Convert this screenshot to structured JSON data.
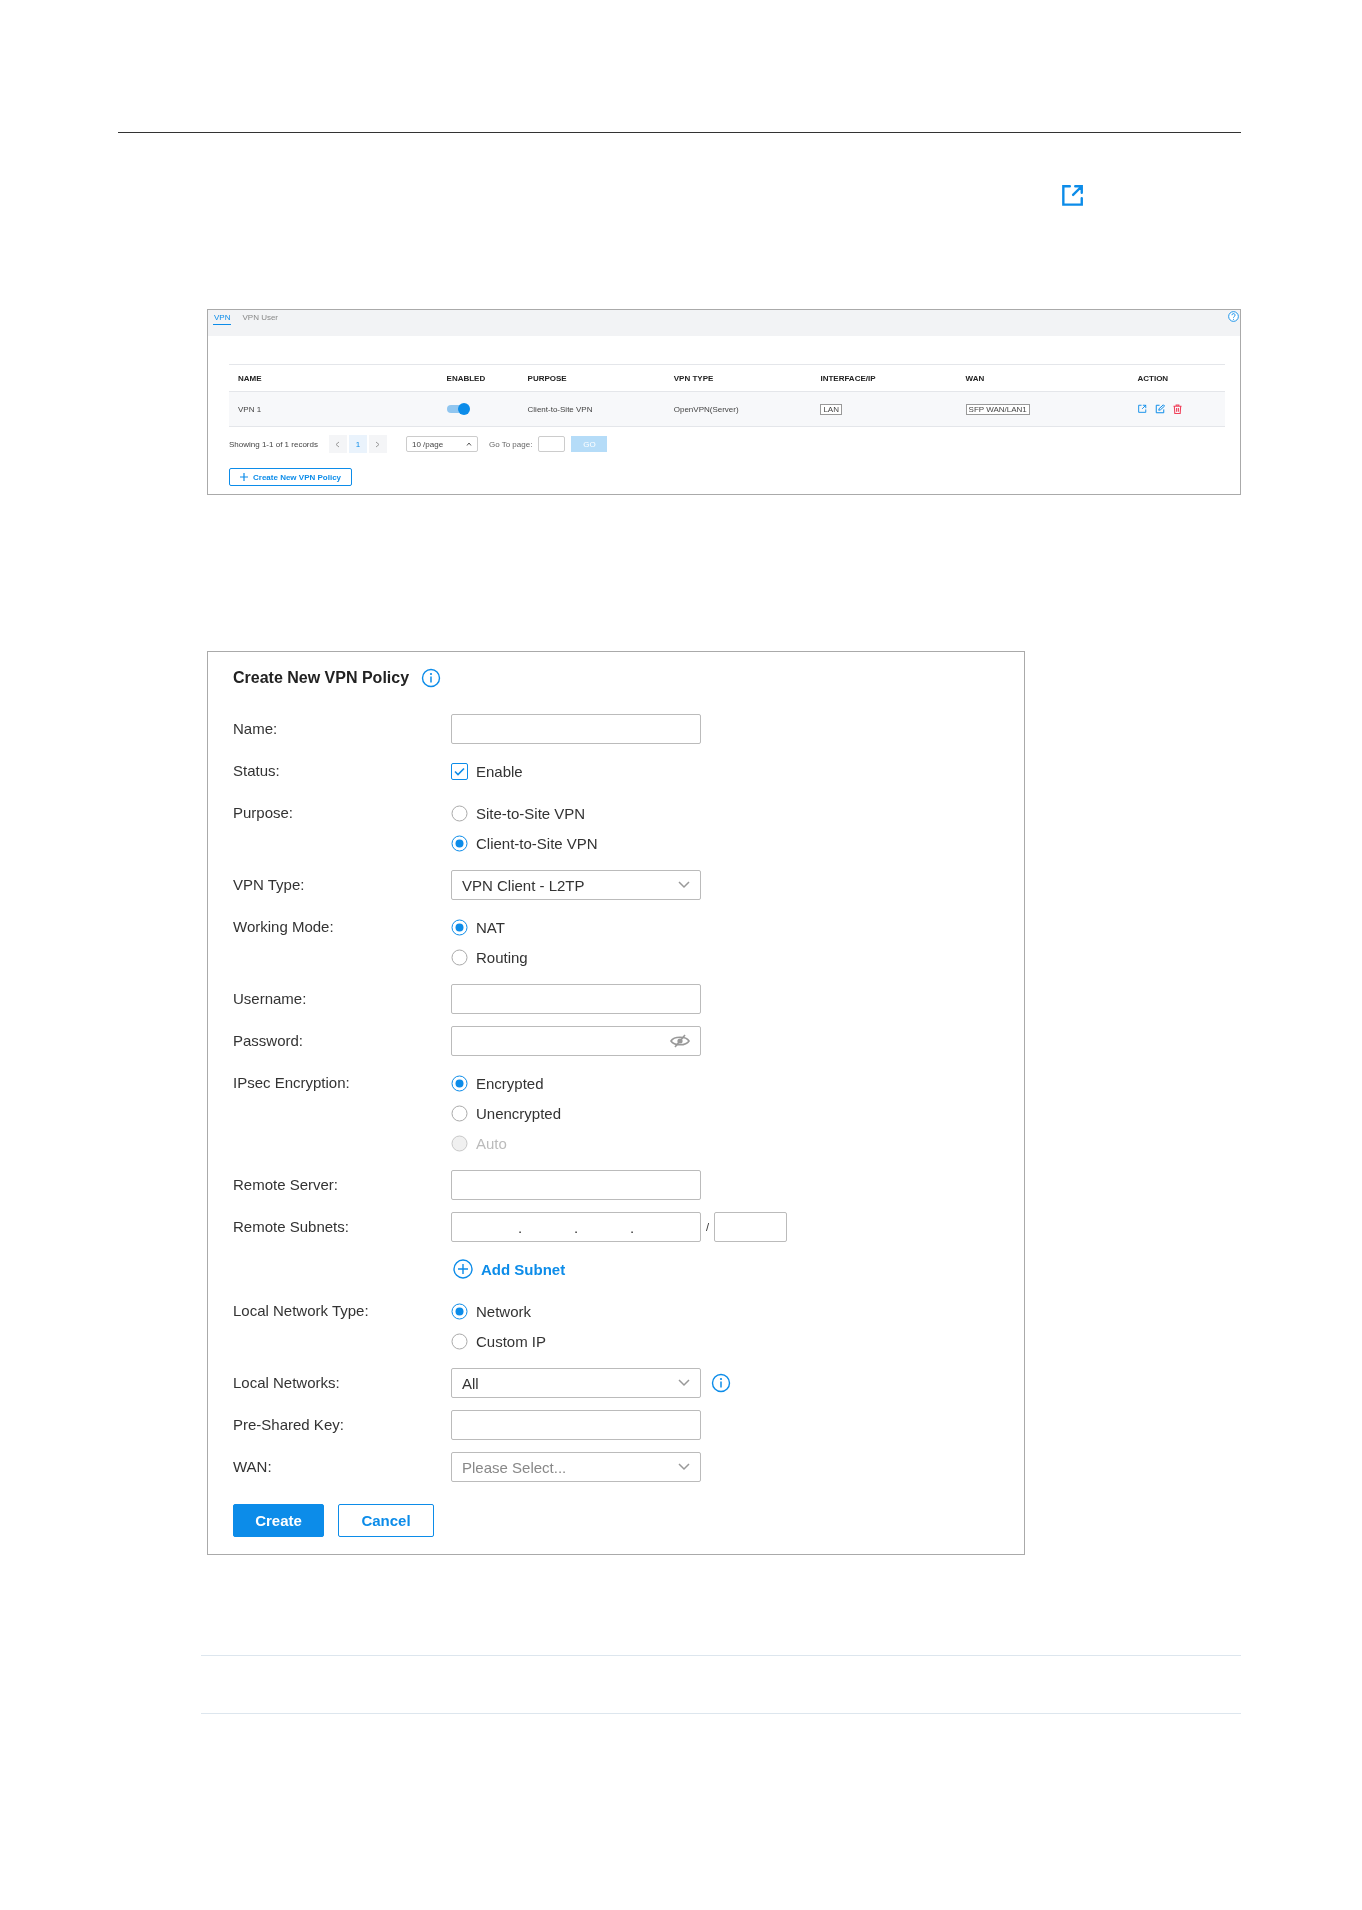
{
  "vpn_table_screenshot": {
    "tabs": [
      {
        "label": "VPN",
        "selected": true
      },
      {
        "label": "VPN User",
        "selected": false
      }
    ],
    "columns": [
      "NAME",
      "ENABLED",
      "PURPOSE",
      "VPN TYPE",
      "INTERFACE/IP",
      "WAN",
      "ACTION"
    ],
    "rows": [
      {
        "name": "VPN 1",
        "enabled": true,
        "purpose": "Client-to-Site VPN",
        "vpn_type": "OpenVPN(Server)",
        "interface_ip": "LAN",
        "wan": "SFP WAN/LAN1"
      }
    ],
    "pagination": {
      "summary": "Showing 1-1 of 1 records",
      "current_page": "1",
      "page_size": "10 /page",
      "goto_label": "Go To page:",
      "go_button": "GO"
    },
    "create_button": "Create New VPN Policy"
  },
  "form": {
    "title": "Create New VPN Policy",
    "fields": [
      {
        "kind": "text",
        "label": "Name:"
      },
      {
        "kind": "checkbox",
        "label": "Status:",
        "option": "Enable",
        "checked": true
      },
      {
        "kind": "radio",
        "label": "Purpose:",
        "options": [
          {
            "label": "Site-to-Site VPN",
            "selected": false,
            "disabled": false
          },
          {
            "label": "Client-to-Site VPN",
            "selected": true,
            "disabled": false
          }
        ]
      },
      {
        "kind": "select",
        "label": "VPN Type:",
        "value": "VPN Client - L2TP",
        "info": false
      },
      {
        "kind": "radio",
        "label": "Working Mode:",
        "options": [
          {
            "label": "NAT",
            "selected": true,
            "disabled": false
          },
          {
            "label": "Routing",
            "selected": false,
            "disabled": false
          }
        ]
      },
      {
        "kind": "text",
        "label": "Username:"
      },
      {
        "kind": "password",
        "label": "Password:"
      },
      {
        "kind": "radio",
        "label": "IPsec Encryption:",
        "options": [
          {
            "label": "Encrypted",
            "selected": true,
            "disabled": false
          },
          {
            "label": "Unencrypted",
            "selected": false,
            "disabled": false
          },
          {
            "label": "Auto",
            "selected": false,
            "disabled": true
          }
        ]
      },
      {
        "kind": "text",
        "label": "Remote Server:"
      },
      {
        "kind": "subnet",
        "label": "Remote Subnets:",
        "separator": ".",
        "mask_separator": "/"
      },
      {
        "kind": "link",
        "label": "Add Subnet"
      },
      {
        "kind": "radio",
        "label": "Local Network Type:",
        "options": [
          {
            "label": "Network",
            "selected": true,
            "disabled": false
          },
          {
            "label": "Custom IP",
            "selected": false,
            "disabled": false
          }
        ]
      },
      {
        "kind": "select",
        "label": "Local Networks:",
        "value": "All",
        "info": true
      },
      {
        "kind": "text",
        "label": "Pre-Shared Key:"
      },
      {
        "kind": "select",
        "label": "WAN:",
        "placeholder": "Please Select...",
        "info": false
      }
    ],
    "buttons": [
      {
        "label": "Create",
        "kind": "primary"
      },
      {
        "label": "Cancel",
        "kind": "secondary"
      }
    ]
  }
}
